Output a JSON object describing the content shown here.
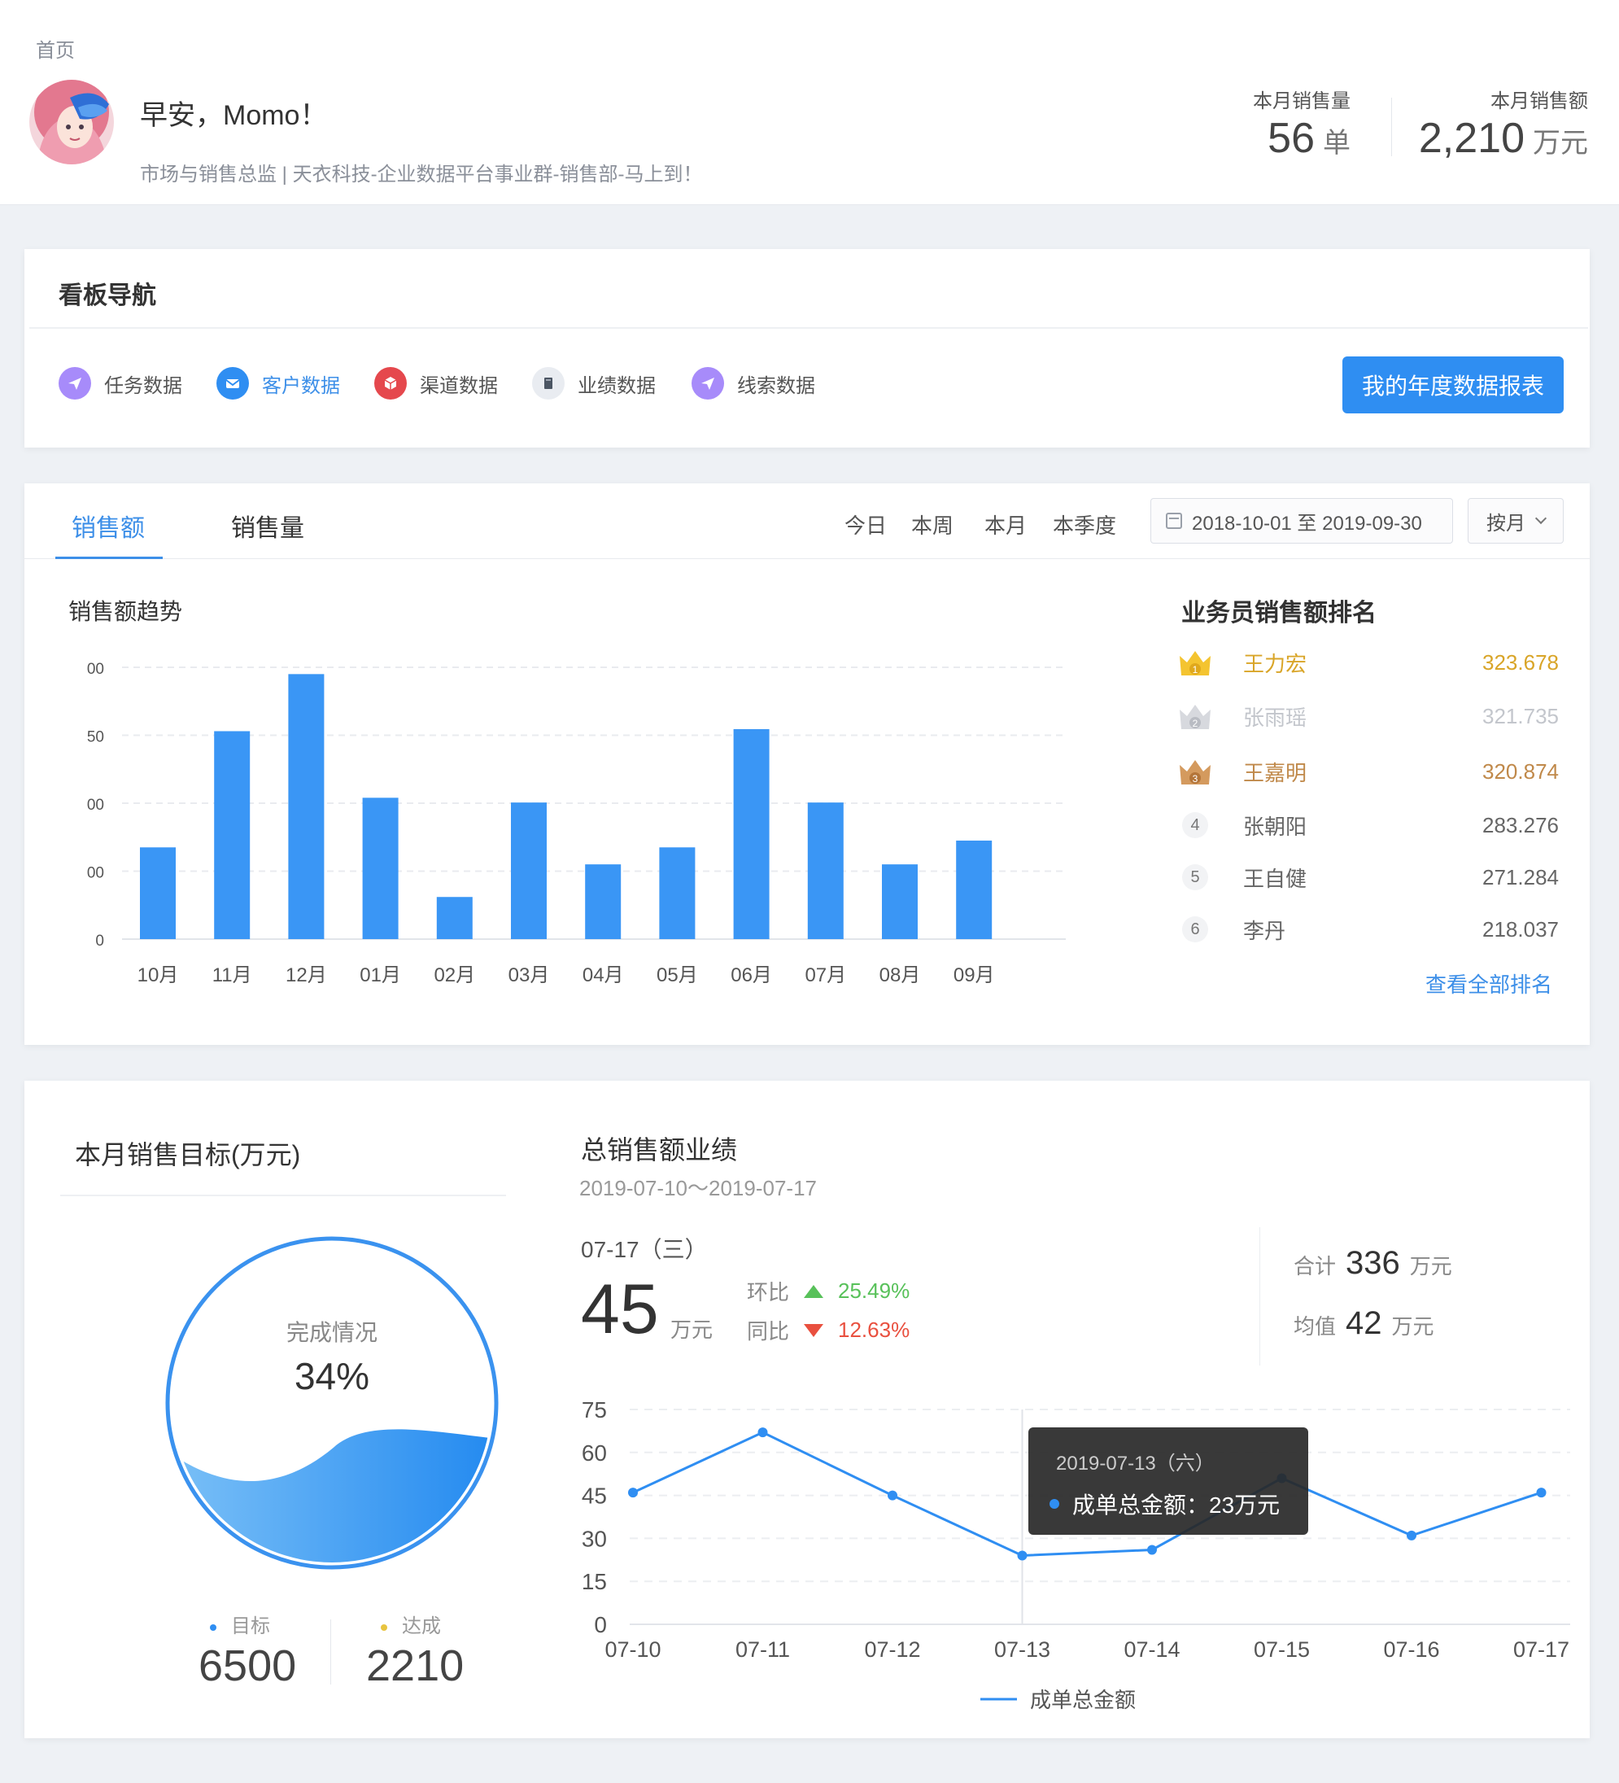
{
  "header": {
    "breadcrumb": "首页",
    "greeting": "早安，Momo！",
    "subtitle": "市场与销售总监 | 天衣科技-企业数据平台事业群-销售部-马上到！",
    "kpis": [
      {
        "label": "本月销售量",
        "value": "56",
        "unit": "单"
      },
      {
        "label": "本月销售额",
        "value": "2,210",
        "unit": "万元"
      }
    ]
  },
  "nav": {
    "title": "看板导航",
    "items": [
      {
        "label": "任务数据",
        "icon": "paper-plane-icon",
        "color": "#a78bfa"
      },
      {
        "label": "客户数据",
        "icon": "envelope-icon",
        "color": "#2f8ef2"
      },
      {
        "label": "渠道数据",
        "icon": "cube-icon",
        "color": "#e5484d"
      },
      {
        "label": "业绩数据",
        "icon": "book-icon",
        "color": "#e9ecf1"
      },
      {
        "label": "线索数据",
        "icon": "paper-plane-icon",
        "color": "#a78bfa"
      }
    ],
    "report_button": "我的年度数据报表"
  },
  "sales": {
    "tabs": [
      "销售额",
      "销售量"
    ],
    "ranges": [
      "今日",
      "本周",
      "本月",
      "本季度"
    ],
    "date_range": "2018-10-01 至 2019-09-30",
    "granularity": "按月",
    "trend_title": "销售额趋势",
    "rank_title": "业务员销售额排名",
    "ranking": [
      {
        "rank": "1",
        "name": "王力宏",
        "value": "323.678",
        "color": "#d9a528"
      },
      {
        "rank": "2",
        "name": "张雨瑶",
        "value": "321.735",
        "color": "#c3c6cc"
      },
      {
        "rank": "3",
        "name": "王嘉明",
        "value": "320.874",
        "color": "#c0894a"
      },
      {
        "rank": "4",
        "name": "张朝阳",
        "value": "283.276",
        "color": "#666666"
      },
      {
        "rank": "5",
        "name": "王自健",
        "value": "271.284",
        "color": "#666666"
      },
      {
        "rank": "6",
        "name": "李丹",
        "value": "218.037",
        "color": "#666666"
      }
    ],
    "view_all": "查看全部排名"
  },
  "target": {
    "title": "本月销售目标(万元)",
    "status_label": "完成情况",
    "percent": "34%",
    "completion": 0.34,
    "goal_label": "目标",
    "goal_value": "6500",
    "achieved_label": "达成",
    "achieved_value": "2210",
    "goal_color": "#2f8ef2",
    "achieved_color": "#e8c440"
  },
  "performance": {
    "title": "总销售额业绩",
    "range": "2019-07-10～2019-07-17",
    "date": "07-17（三）",
    "value": "45",
    "unit": "万元",
    "mom_label": "环比",
    "mom_value": "25.49%",
    "yoy_label": "同比",
    "yoy_value": "12.63%",
    "sum_label": "合计",
    "sum_value": "336",
    "sum_unit": "万元",
    "avg_label": "均值",
    "avg_value": "42",
    "avg_unit": "万元",
    "tooltip_date": "2019-07-13（六）",
    "tooltip_text": "成单总金额：23万元"
  },
  "chart_data": [
    {
      "type": "bar",
      "title": "销售额趋势",
      "categories": [
        "10月",
        "11月",
        "12月",
        "01月",
        "02月",
        "03月",
        "04月",
        "05月",
        "06月",
        "07月",
        "08月",
        "09月"
      ],
      "values": [
        135,
        306,
        390,
        208,
        62,
        201,
        110,
        135,
        309,
        201,
        110,
        145
      ],
      "ytick_labels": [
        "0",
        "00",
        "00",
        "50",
        "00"
      ],
      "ylim": [
        0,
        400
      ],
      "color": "#3a96f5",
      "grid": true
    },
    {
      "type": "line",
      "x": [
        "07-10",
        "07-11",
        "07-12",
        "07-13",
        "07-14",
        "07-15",
        "07-16",
        "07-17"
      ],
      "series": [
        {
          "name": "成单总金额",
          "values": [
            46,
            67,
            45,
            24,
            26,
            51,
            31,
            46
          ],
          "color": "#2f8ef2"
        }
      ],
      "yticks": [
        "0",
        "15",
        "30",
        "45",
        "60",
        "75"
      ],
      "ylim": [
        0,
        75
      ],
      "grid": true,
      "legend": "bottom"
    }
  ]
}
